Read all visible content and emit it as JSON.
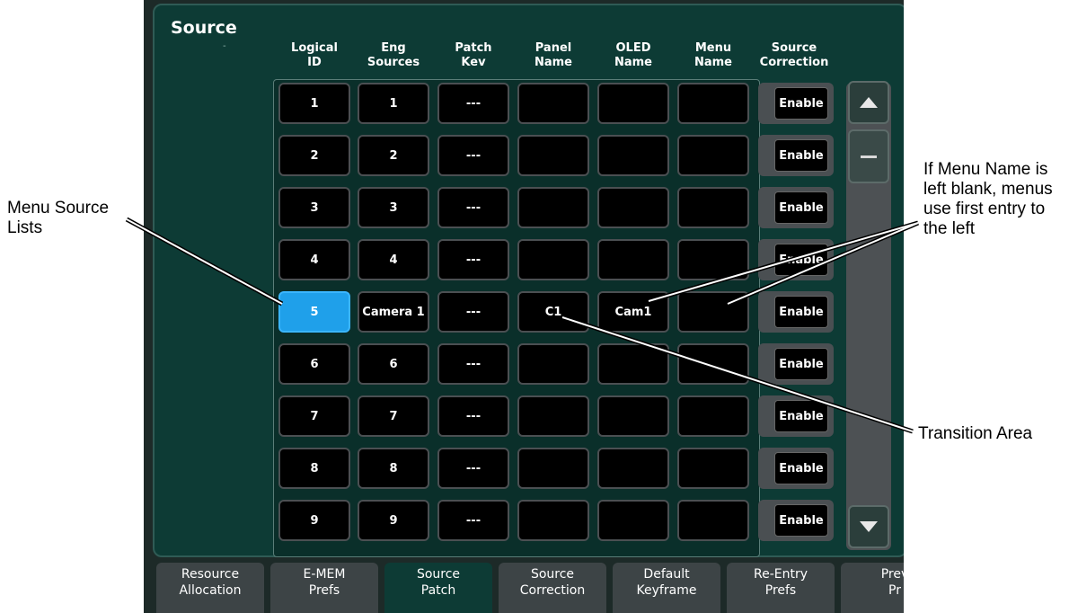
{
  "panel": {
    "title": "Source",
    "title_mark": "-"
  },
  "columns": [
    {
      "line1": "Logical",
      "line2": "ID"
    },
    {
      "line1": "Eng",
      "line2": "Sources"
    },
    {
      "line1": "Patch",
      "line2": "Kev"
    },
    {
      "line1": "Panel",
      "line2": "Name"
    },
    {
      "line1": "OLED",
      "line2": "Name"
    },
    {
      "line1": "Menu",
      "line2": "Name"
    },
    {
      "line1": "Source",
      "line2": "Correction"
    }
  ],
  "rows": [
    {
      "logical_id": "1",
      "eng_source": "1",
      "patch_key": "---",
      "panel_name": "",
      "oled_name": "",
      "menu_name": "",
      "correction": "Enable"
    },
    {
      "logical_id": "2",
      "eng_source": "2",
      "patch_key": "---",
      "panel_name": "",
      "oled_name": "",
      "menu_name": "",
      "correction": "Enable"
    },
    {
      "logical_id": "3",
      "eng_source": "3",
      "patch_key": "---",
      "panel_name": "",
      "oled_name": "",
      "menu_name": "",
      "correction": "Enable"
    },
    {
      "logical_id": "4",
      "eng_source": "4",
      "patch_key": "---",
      "panel_name": "",
      "oled_name": "",
      "menu_name": "",
      "correction": "Enable"
    },
    {
      "logical_id": "5",
      "eng_source": "Camera 1",
      "patch_key": "---",
      "panel_name": "C1",
      "oled_name": "Cam1",
      "menu_name": "",
      "correction": "Enable",
      "selected": true
    },
    {
      "logical_id": "6",
      "eng_source": "6",
      "patch_key": "---",
      "panel_name": "",
      "oled_name": "",
      "menu_name": "",
      "correction": "Enable"
    },
    {
      "logical_id": "7",
      "eng_source": "7",
      "patch_key": "---",
      "panel_name": "",
      "oled_name": "",
      "menu_name": "",
      "correction": "Enable"
    },
    {
      "logical_id": "8",
      "eng_source": "8",
      "patch_key": "---",
      "panel_name": "",
      "oled_name": "",
      "menu_name": "",
      "correction": "Enable"
    },
    {
      "logical_id": "9",
      "eng_source": "9",
      "patch_key": "---",
      "panel_name": "",
      "oled_name": "",
      "menu_name": "",
      "correction": "Enable"
    }
  ],
  "scrollbar": {
    "up_icon": "triangle-up-icon",
    "down_icon": "triangle-down-icon",
    "thumb_icon": "minus-icon"
  },
  "tabs": [
    {
      "line1": "Resource",
      "line2": "Allocation",
      "active": false
    },
    {
      "line1": "E-MEM",
      "line2": "Prefs",
      "active": false
    },
    {
      "line1": "Source",
      "line2": "Patch",
      "active": true
    },
    {
      "line1": "Source",
      "line2": "Correction",
      "active": false
    },
    {
      "line1": "Default",
      "line2": "Keyframe",
      "active": false
    },
    {
      "line1": "Re-Entry",
      "line2": "Prefs",
      "active": false
    },
    {
      "line1": "Prev",
      "line2": "Pr",
      "active": false
    }
  ],
  "callouts": {
    "menu_source": {
      "line1": "Menu Source",
      "line2": "Lists"
    },
    "menu_name": {
      "line1": "If Menu Name is",
      "line2": "left blank, menus",
      "line3": "use first entry to",
      "line4": "the left"
    },
    "transition": {
      "line1": "Transition Area"
    }
  },
  "colors": {
    "panel_bg": "#0d3b35",
    "selected_cell": "#1fa0ea",
    "cell_bg": "#000000",
    "tab_bg": "#3d4446"
  }
}
